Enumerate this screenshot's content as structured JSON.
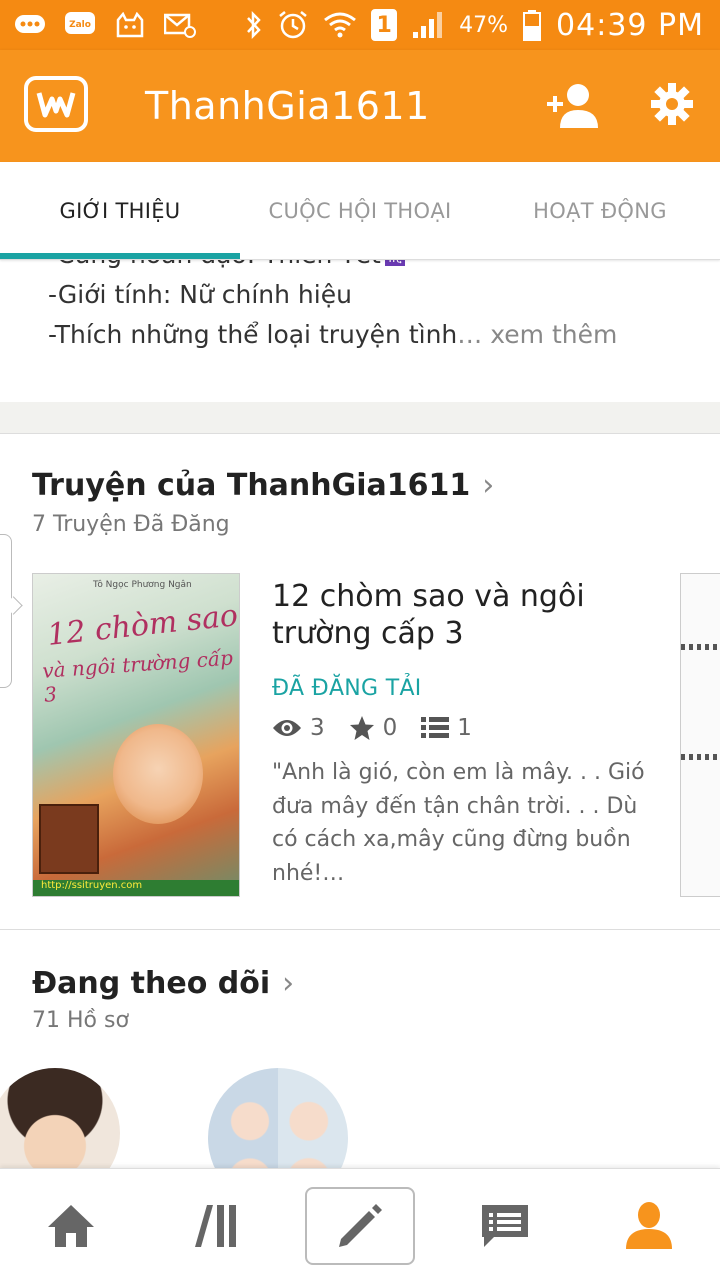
{
  "status_bar": {
    "left_icons": [
      "messages-icon",
      "zalo-icon",
      "cat-icon",
      "mail-icon"
    ],
    "zalo_label": "Zalo",
    "sim": "1",
    "battery": "47%",
    "time": "04:39 PM"
  },
  "app_bar": {
    "title": "ThanhGia1611",
    "logo_letter": "w",
    "accent": "#f7941d"
  },
  "tabs": [
    {
      "label": "GIỚI THIỆU",
      "active": true
    },
    {
      "label": "CUỘC HỘI THOẠI",
      "active": false
    },
    {
      "label": "HOẠT ĐỘNG",
      "active": false
    }
  ],
  "about": {
    "partial_line": "-Cung hoàn đạo: Thiên Yết",
    "zodiac_badge": "♏",
    "gender_line": "-Giới tính: Nữ chính hiệu",
    "likes_line": "-Thích những thể loại truyện tình",
    "ellipsis": "…",
    "see_more": "xem thêm"
  },
  "stories_section": {
    "title": "Truyện của ThanhGia1611",
    "subtitle": "7 Truyện Đã Đăng",
    "story": {
      "cover_small": "Tô Ngọc Phương Ngân",
      "cover_line1": "12 chòm sao",
      "cover_line2": "và ngôi trường cấp 3",
      "cover_footer": "http://ssitruyen.com",
      "title": "12 chòm sao và ngôi trường cấp 3",
      "status": "ĐÃ ĐĂNG TẢI",
      "reads": "3",
      "votes": "0",
      "parts": "1",
      "description": "\"Anh là gió, còn em là mây. . . Gió đưa mây đến tận chân trời. . . Dù có cách xa,mây cũng đừng buồn nhé!…"
    }
  },
  "following_section": {
    "title": "Đang theo dõi",
    "subtitle": "71 Hồ sơ"
  },
  "bottom_nav": [
    {
      "icon": "home-icon"
    },
    {
      "icon": "library-icon"
    },
    {
      "icon": "write-icon"
    },
    {
      "icon": "messages-icon"
    },
    {
      "icon": "profile-icon",
      "active": true
    }
  ],
  "colors": {
    "status_bar": "#f58a12",
    "teal": "#1aa3a3",
    "orange": "#f7941d"
  }
}
